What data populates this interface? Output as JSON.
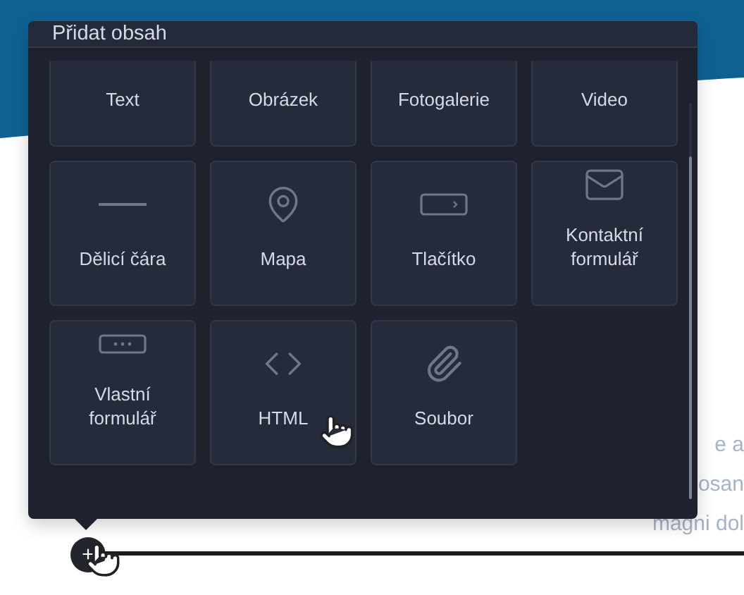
{
  "dialog": {
    "title": "Přidat obsah",
    "items": [
      {
        "label": "Text",
        "kind": "none"
      },
      {
        "label": "Obrázek",
        "kind": "none"
      },
      {
        "label": "Fotogalerie",
        "kind": "none"
      },
      {
        "label": "Video",
        "kind": "none"
      },
      {
        "label": "Dělicí čára",
        "kind": "divider"
      },
      {
        "label": "Mapa",
        "kind": "pin"
      },
      {
        "label": "Tlačítko",
        "kind": "button"
      },
      {
        "label": "Kontaktní formulář",
        "kind": "mail"
      },
      {
        "label": "Vlastní formulář",
        "kind": "form"
      },
      {
        "label": "HTML",
        "kind": "code"
      },
      {
        "label": "Soubor",
        "kind": "clip"
      }
    ]
  },
  "page_text": [
    "e a",
    "osan",
    "magni dol"
  ],
  "add_button": {
    "label": "+"
  }
}
